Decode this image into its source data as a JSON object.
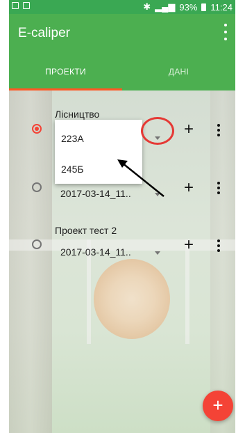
{
  "statusbar": {
    "battery": "93%",
    "time": "11:24"
  },
  "app": {
    "title": "E-caliper"
  },
  "tabs": [
    {
      "label": "ПРОЕКТИ",
      "active": true
    },
    {
      "label": "ДАНІ",
      "active": false
    }
  ],
  "projects": [
    {
      "name": "Лісництво",
      "selected_value": "223А",
      "checked": true
    },
    {
      "name": "",
      "selected_value": "2017-03-14_11..",
      "checked": false
    },
    {
      "name": "Проект тест 2",
      "selected_value": "2017-03-14_11..",
      "checked": false
    }
  ],
  "dropdown": {
    "options": [
      "223А",
      "245Б"
    ]
  },
  "icons": {
    "add": "+",
    "fab": "+"
  },
  "colors": {
    "primary": "#4caf50",
    "accent": "#f44336",
    "tab_indicator": "#ff5722"
  }
}
